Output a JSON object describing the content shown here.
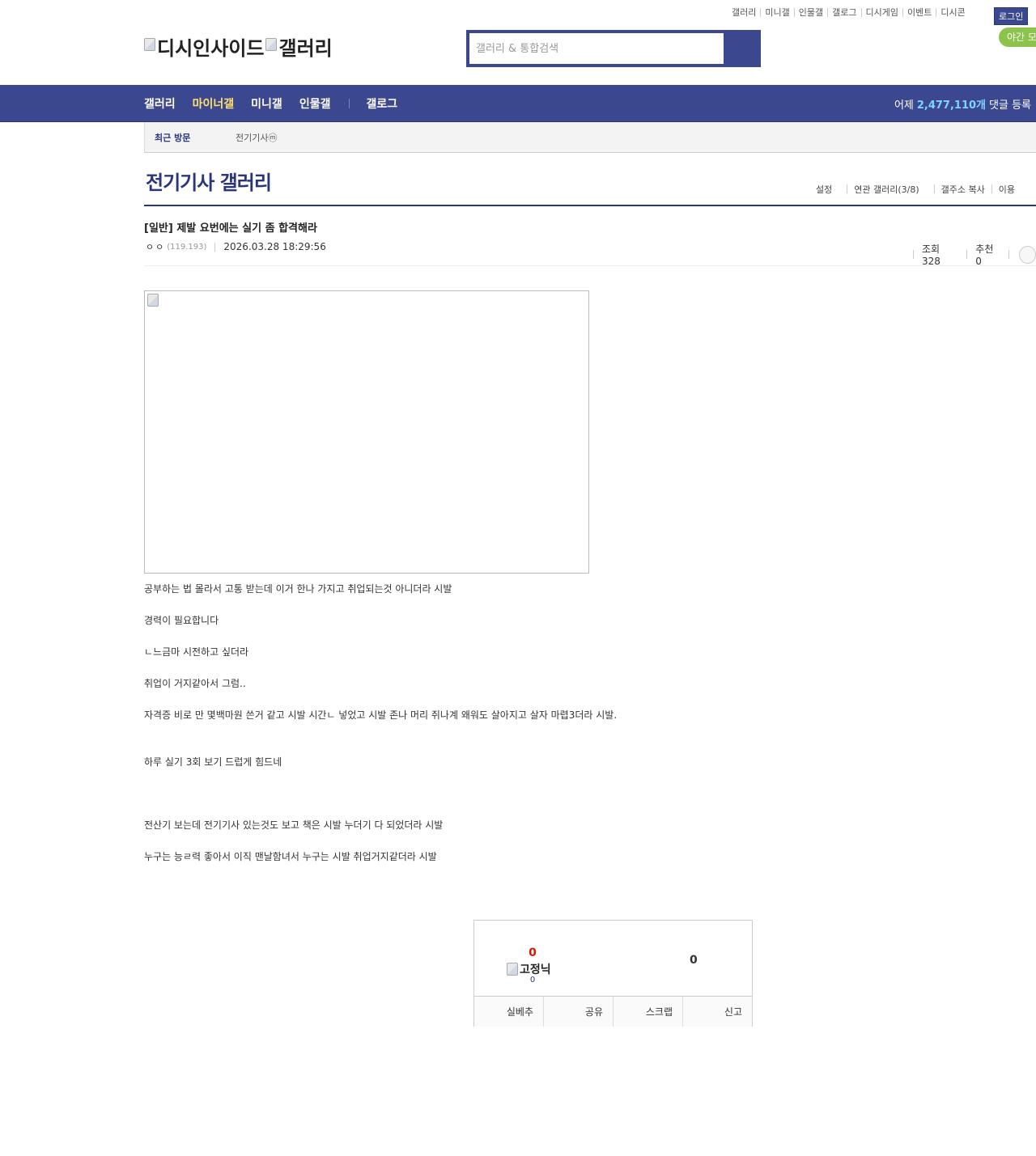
{
  "top_links": [
    "갤러리",
    "미니갤",
    "인물갤",
    "갤로그",
    "디시게임",
    "이벤트",
    "디시콘"
  ],
  "login_label": "로그인",
  "night_mode_label": "야간 모",
  "logo": {
    "part1": "디시인사이드",
    "part2": "갤러리"
  },
  "search": {
    "placeholder": "갤러리 & 통합검색"
  },
  "nav": {
    "items": [
      "갤러리",
      "마이너갤",
      "미니갤",
      "인물갤",
      "갤로그"
    ],
    "stat_prefix": "어제",
    "stat_count": "2,477,110개",
    "stat_suffix": "댓글 등록"
  },
  "recent": {
    "label": "최근 방문",
    "gallery": "전기기사ⓜ"
  },
  "gallery": {
    "title": "전기기사 갤러리",
    "links": [
      "설정",
      "연관 갤러리(3/8)",
      "갤주소 복사",
      "이용"
    ]
  },
  "post": {
    "title": "[일반] 제발 요번에는 실기 좀 합격해라",
    "author": "ㅇㅇ",
    "ip": "(119.193)",
    "date": "2026.03.28 18:29:56",
    "views": "조회 328",
    "recommend": "추천 0",
    "paragraphs": [
      "공부하는 법 몰라서 고통 받는데  이거 한나 가지고 취업되는것 아니더라 시발",
      "경력이 필요합니다",
      "ㄴ느금마 시전하고 싶더라",
      "취업이 거지같아서 그럼..",
      "자격증 비로 만 몇백마원 쓴거 같고 시발 시간ㄴ  넣었고 시발 존나 머리 쥐나계 왜워도 살아지고 살자 마렵3더라 시발.",
      "하루 실기 3회 보기 드럽게 힘드네",
      "전산기 보는데  전기기사  있는것도 보고 책은 시발  누더기 다 되었더라 시발",
      "누구는  능ㄹ력 좋아서   이직 맨날함녀서  누구는 시발 취업거지같더라 시발"
    ]
  },
  "recommend_box": {
    "up_count": "0",
    "fixnick_label": "고정닉",
    "fixnick_count": "0",
    "down_count": "0",
    "buttons": [
      "실베추",
      "공유",
      "스크랩",
      "신고"
    ]
  }
}
